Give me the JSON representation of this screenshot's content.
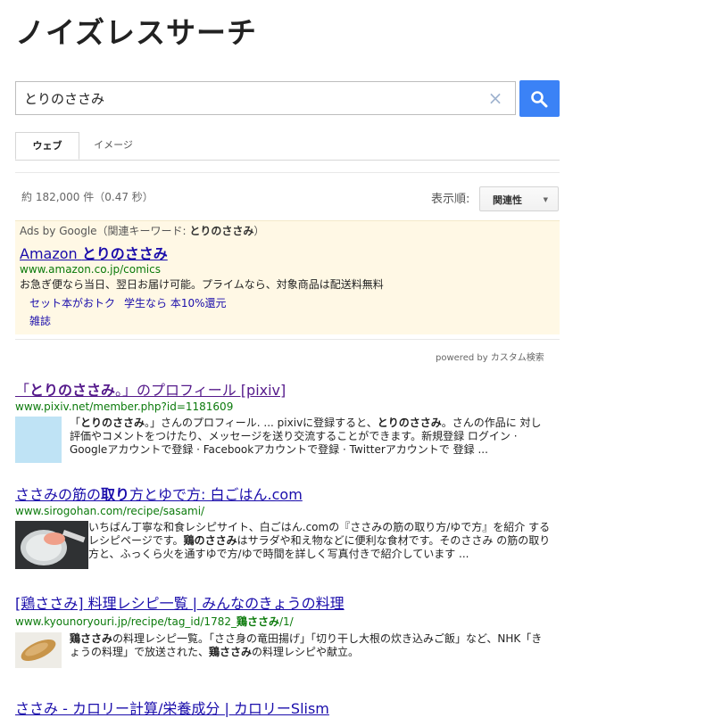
{
  "app": {
    "title": "ノイズレスサーチ"
  },
  "search": {
    "value": "とりのささみ",
    "clear_icon": "×"
  },
  "tabs": [
    {
      "label": "ウェブ",
      "active": true
    },
    {
      "label": "イメージ",
      "active": false
    }
  ],
  "summary": {
    "count": "約 182,000 件（0.47 秒）"
  },
  "sort": {
    "label": "表示順:",
    "selected": "関連性"
  },
  "ads": {
    "label_prefix": "Ads by Google（関連キーワード: ",
    "keyword": "とりのささみ",
    "label_suffix": "）",
    "title_prefix": "Amazon ",
    "title_bold": "とりのささみ",
    "url": "www.amazon.co.jp/comics",
    "description": "お急ぎ便なら当日、翌日お届け可能。プライムなら、対象商品は配送料無料",
    "sitelinks": [
      "セット本がおトク",
      "学生なら 本10%還元",
      "雑誌"
    ]
  },
  "powered_by": "powered by カスタム検索",
  "results": [
    {
      "title_parts": [
        {
          "text": "「",
          "bold": false
        },
        {
          "text": "とりのささみ",
          "bold": true
        },
        {
          "text": "。」のプロフィール [pixiv]",
          "bold": false
        }
      ],
      "url": "www.pixiv.net/member.php?id=1181609",
      "snippet_parts": [
        {
          "text": "「",
          "bold": false
        },
        {
          "text": "とりのささみ",
          "bold": true
        },
        {
          "text": "。」さんのプロフィール. ... pixivに登録すると、",
          "bold": false
        },
        {
          "text": "とりのささみ",
          "bold": true
        },
        {
          "text": "。さんの作品に 対し評価やコメントをつけたり、メッセージを送り交流することができます。新規登録 ログイン · Googleアカウントで登録 · Facebookアカウントで登録 · Twitterアカウントで 登録 ...",
          "bold": false
        }
      ],
      "thumb": "blank-thumbnail"
    },
    {
      "title_parts": [
        {
          "text": "ささみ",
          "bold": false
        },
        {
          "text": "の筋の",
          "bold": false
        },
        {
          "text": "取り",
          "bold": true
        },
        {
          "text": "方とゆで方: 白ごはん.com",
          "bold": false
        }
      ],
      "url": "www.sirogohan.com/recipe/sasami/",
      "snippet_parts": [
        {
          "text": "いちばん丁寧な和食レシピサイト、白ごはん.comの『ささみの筋の取り方/ゆで方』を紹介 するレシピページです。",
          "bold": false
        },
        {
          "text": "鶏のささみ",
          "bold": true
        },
        {
          "text": "はサラダや和え物などに便利な食材です。そのささみ の筋の取り方と、ふっくら火を通すゆで方/ゆで時間を詳しく写真付きで紹介しています ...",
          "bold": false
        }
      ],
      "thumb": "pan-cooking-photo"
    },
    {
      "title_parts": [
        {
          "text": "[鶏ささみ] 料理レシピ一覧 | みんなのきょうの料理",
          "bold": false
        }
      ],
      "url_parts": [
        {
          "text": "www.kyounoryouri.jp/recipe/tag_id/1782_",
          "bold": false
        },
        {
          "text": "鶏ささみ",
          "bold": true
        },
        {
          "text": "/1/",
          "bold": false
        }
      ],
      "snippet_parts": [
        {
          "text": "鶏ささみ",
          "bold": true
        },
        {
          "text": "の料理レシピ一覧。「ささ身の竜田揚げ」「切り干し大根の炊き込みご飯」など、NHK「きょうの料理」で放送された、",
          "bold": false
        },
        {
          "text": "鶏ささみ",
          "bold": true
        },
        {
          "text": "の料理レシピや献立。",
          "bold": false
        }
      ],
      "thumb": "fried-chicken-photo"
    },
    {
      "title_parts": [
        {
          "text": "ささみ",
          "bold": false
        },
        {
          "text": " - カロリー計算/栄養成分 | カロリーSlism",
          "bold": false
        }
      ]
    }
  ]
}
